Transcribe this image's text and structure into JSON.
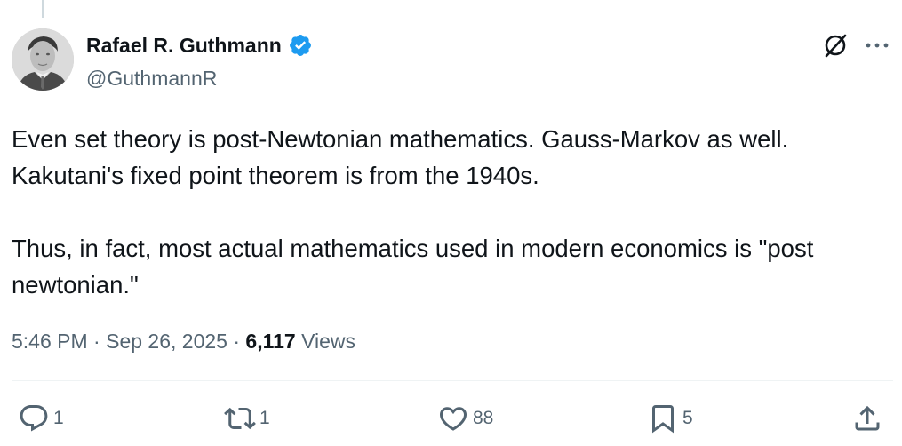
{
  "author": {
    "name": "Rafael R. Guthmann",
    "handle": "@GuthmannR",
    "verified_color": "#1d9bf0",
    "verified_icon": "verified-badge-icon",
    "avatar_icon": "avatar-photo"
  },
  "header_actions": {
    "grok_icon": "grok-icon",
    "more_icon": "more-options-icon"
  },
  "tweet": {
    "paragraphs": [
      {
        "lines": [
          "Even set theory is post-Newtonian mathematics. Gauss-Markov as well.",
          "Kakutani's fixed point theorem is from the 1940s."
        ]
      },
      {
        "lines": [
          "Thus, in fact, most actual mathematics used in modern economics is \"post",
          "newtonian.\""
        ]
      }
    ]
  },
  "meta": {
    "time": "5:46 PM",
    "separator": "·",
    "date": "Sep 26, 2025",
    "views_count": "6,117",
    "views_label": "Views"
  },
  "actions": {
    "reply": {
      "icon": "reply-icon",
      "count": "1"
    },
    "retweet": {
      "icon": "retweet-icon",
      "count": "1"
    },
    "like": {
      "icon": "heart-icon",
      "count": "88"
    },
    "bookmark": {
      "icon": "bookmark-icon",
      "count": "5"
    },
    "share": {
      "icon": "share-icon"
    }
  },
  "colors": {
    "text_primary": "#0f1419",
    "text_secondary": "#536471",
    "accent": "#1d9bf0",
    "divider": "#eff3f4"
  }
}
